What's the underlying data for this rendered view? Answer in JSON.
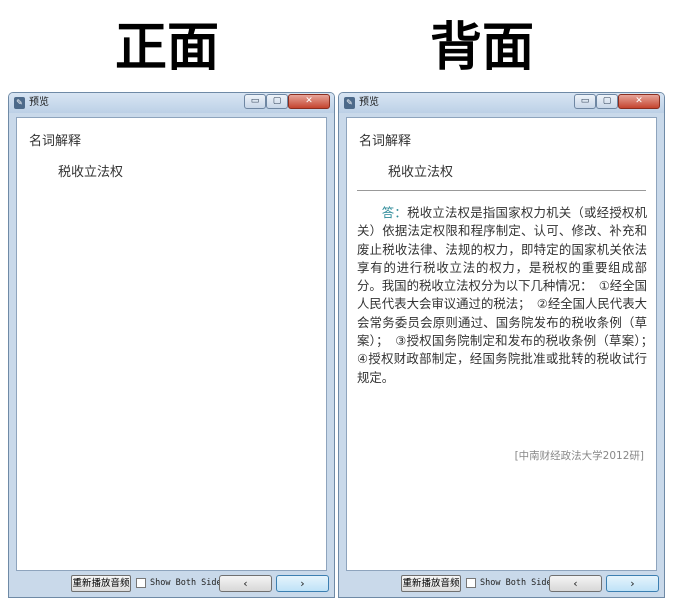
{
  "labels": {
    "front": "正面",
    "back": "背面"
  },
  "window": {
    "title": "预览",
    "icon": "app-icon",
    "minimize": "▭",
    "maximize": "▢",
    "close": "✕"
  },
  "card": {
    "label": "名词解释",
    "term": "税收立法权",
    "answer_prefix": "答：",
    "answer_body": "税收立法权是指国家权力机关（或经授权机关）依据法定权限和程序制定、认可、修改、补充和废止税收法律、法规的权力，即特定的国家机关依法享有的进行税收立法的权力，是税权的重要组成部分。我国的税收立法权分为以下几种情况：　①经全国人民代表大会审议通过的税法；　②经全国人民代表大会常务委员会原则通过、国务院发布的税收条例（草案）；　③授权国务院制定和发布的税收条例（草案）；　④授权财政部制定，经国务院批准或批转的税收试行规定。",
    "source": "[中南财经政法大学2012研]"
  },
  "toolbar": {
    "replay": "重新播放音频",
    "show_both_sides": "Show Both Sides",
    "prev": "‹",
    "next": "›"
  },
  "colors": {
    "accent": "#2e8b99",
    "frame": "#c9d9ea"
  }
}
